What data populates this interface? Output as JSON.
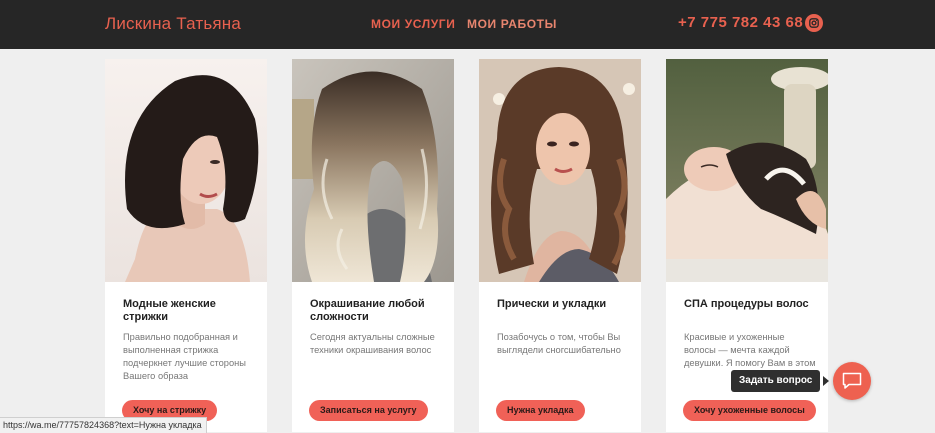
{
  "header": {
    "brand": "Лискина Татьяна",
    "nav": [
      {
        "label": "МОИ УСЛУГИ"
      },
      {
        "label": "МОИ РАБОТЫ"
      }
    ],
    "phone": "+7 775 782 43 68",
    "social_icon": "instagram-icon"
  },
  "cards": [
    {
      "title": "Модные женские стрижки",
      "description": "Правильно подобранная и выполненная стрижка подчеркнет лучшие стороны Вашего образа",
      "button": "Хочу на стрижку"
    },
    {
      "title": "Окрашивание любой сложности",
      "description": "Сегодня актуальны сложные техники окрашивания волос",
      "button": "Записаться на услугу"
    },
    {
      "title": "Прически и укладки",
      "description": "Позабочусь о том, чтобы Вы выглядели сногсшибательно",
      "button": "Нужна укладка"
    },
    {
      "title": "СПА процедуры волос",
      "description": "Красивые и ухоженные волосы — мечта каждой девушки. Я помогу Вам в этом",
      "button": "Хочу ухоженные волосы"
    }
  ],
  "chat": {
    "tooltip": "Задать вопрос",
    "icon": "chat-bubble-icon"
  },
  "status_url": "https://wa.me/77757824368?text=Нужна укладка",
  "colors": {
    "accent": "#e8614f",
    "button": "#f06157",
    "header_bg": "#262626",
    "page_bg": "#efefef"
  }
}
